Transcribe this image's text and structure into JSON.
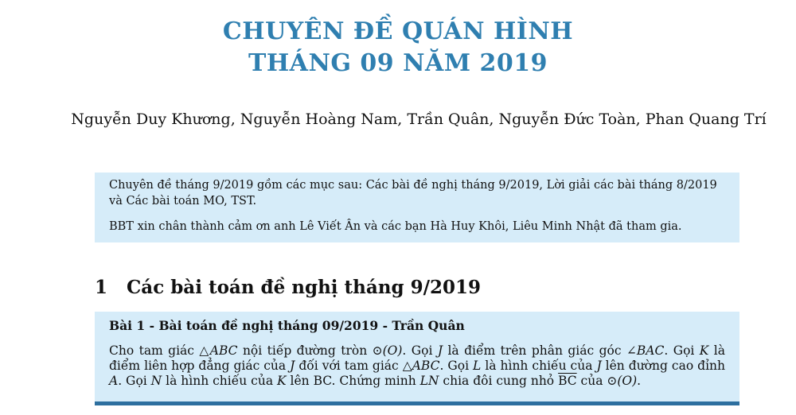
{
  "title_line1": "CHUYÊN ĐỀ QUÁN HÌNH",
  "title_line2": "THÁNG 09 NĂM 2019",
  "authors": "Nguyễn Duy Khương, Nguyễn Hoàng Nam, Trần Quân, Nguyễn Đức Toàn, Phan Quang Trí",
  "note": {
    "paragraph1": "Chuyên đề tháng 9/2019 gồm các mục sau: Các bài đề nghị tháng 9/2019, Lời giải các bài tháng 8/2019 và Các bài toán MO, TST.",
    "paragraph2": "BBT xin chân thành cảm ơn anh Lê Viết Ân và các bạn Hà Huy Khôi, Liêu Minh Nhật đã tham gia."
  },
  "section": {
    "number": "1",
    "title": "Các bài toán đề nghị tháng 9/2019"
  },
  "problem": {
    "title": "Bài 1 - Bài toán đề nghị tháng 09/2019 - Trần Quân",
    "body": {
      "t1": "Cho tam giác ",
      "m1": "△ABC",
      "t2": " nội tiếp đường tròn ",
      "m2": "⊙(O)",
      "t3": ". Gọi ",
      "m3": "J",
      "t4": " là điểm trên phân giác góc ",
      "m4": "∠BAC",
      "t5": ". Gọi ",
      "m5": "K",
      "t6": " là điểm liên hợp đẳng giác của ",
      "m6": "J",
      "t7": " đối với tam giác ",
      "m7": "△ABC",
      "t8": ". Gọi ",
      "m8": "L",
      "t9": " là hình chiếu của ",
      "m9": "J",
      "t10": " lên đường cao đỉnh ",
      "m10": "A",
      "t11": ". Gọi ",
      "m11": "N",
      "t12": " là hình chiếu của ",
      "m12": "K",
      "t13": " lên BC. Chứng minh ",
      "m13": "LN",
      "t14": " chia đôi cung nhỏ ",
      "m14": "BC",
      "t15": " của ",
      "m15": "⊙(O)",
      "t16": "."
    }
  }
}
